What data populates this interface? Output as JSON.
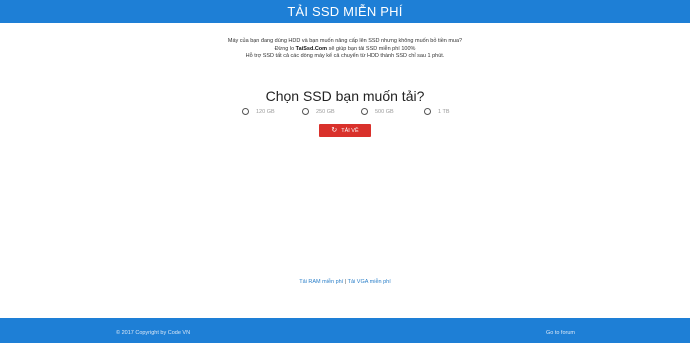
{
  "header": {
    "title": "TẢI SSD MIỄN PHÍ"
  },
  "intro": {
    "line1": "Máy của bạn đang dùng HDD và bạn muốn nâng cấp lên SSD nhưng không muốn bỏ tiền mua?",
    "line2_prefix": "Đừng lo ",
    "line2_brand": "TaiSsd.Com",
    "line2_suffix": " sẽ giúp bạn tải SSD miễn phí 100%",
    "line3": "Hỗ trợ SSD tất cả các dòng máy kể cả chuyển từ HDD thành SSD chỉ sau 1 phút."
  },
  "question": "Chọn SSD bạn muốn tải?",
  "options": [
    {
      "label": "120 GB"
    },
    {
      "label": "250 GB"
    },
    {
      "label": "500 GB"
    },
    {
      "label": "1 TB"
    }
  ],
  "download_button": {
    "label": "TẢI VỀ",
    "icon": "refresh-icon",
    "color": "#d9312b"
  },
  "links": {
    "ram": "Tải RAM miễn phí",
    "separator": " | ",
    "vga": "Tải VGA miễn phí"
  },
  "footer": {
    "copyright": "© 2017 Copyright by Code VN",
    "forum": "Go to forum"
  },
  "colors": {
    "brand": "#1e7fd6",
    "button": "#d9312b",
    "link": "#2a7fc9"
  }
}
